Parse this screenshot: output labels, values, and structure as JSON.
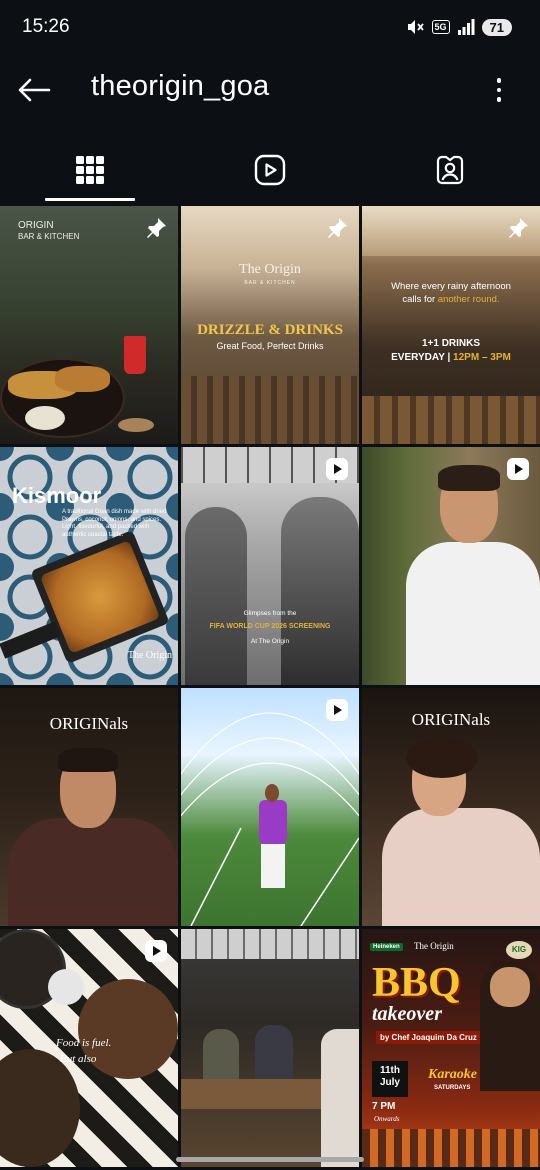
{
  "status_bar": {
    "time": "15:26",
    "network": "5G",
    "battery": "71"
  },
  "header": {
    "username": "theorigin_goa"
  },
  "tabs": [
    {
      "name": "posts-grid",
      "icon": "grid-icon",
      "selected": true
    },
    {
      "name": "reels",
      "icon": "reels-play-icon",
      "selected": false
    },
    {
      "name": "tagged",
      "icon": "tagged-person-icon",
      "selected": false
    }
  ],
  "posts": [
    {
      "pinned": true,
      "logo_line1": "ORIGIN",
      "logo_line2": "BAR & KITCHEN"
    },
    {
      "pinned": true,
      "logo": "The Origin",
      "logo_sub": "BAR & KITCHEN",
      "headline": "DRIZZLE & DRINKS",
      "subline": "Great Food, Perfect Drinks"
    },
    {
      "pinned": true,
      "line1": "Where every rainy afternoon",
      "line2a": "calls for ",
      "line2b": "another round.",
      "offer": "1+1 DRINKS",
      "hours_a": "EVERYDAY | ",
      "hours_b": "12PM – 3PM"
    },
    {
      "title": "Kismoor",
      "desc": "A traditional Goan dish made with dried Prawns, coconut, onions, and spices. Light, flavourful, and packed with authentic coastal taste.",
      "logo": "The Origin"
    },
    {
      "video": true,
      "line1": "Glimpses from the",
      "line2": "FIFA WORLD CUP 2026 SCREENING",
      "line3": "At The Origin"
    },
    {
      "video": true
    },
    {
      "logo": "ORIGINals"
    },
    {
      "video": true
    },
    {
      "logo": "ORIGINals"
    },
    {
      "video": true,
      "line1": "Food is fuel.",
      "line2": "But also"
    },
    {},
    {
      "brand1": "Heineken",
      "brand2": "The Origin",
      "title1": "BBQ",
      "title2": "takeover",
      "chef": "by Chef Joaquim Da Cruz",
      "date": "11th July",
      "time": "7 PM",
      "onwards": "Onwards",
      "event1": "Karaoke",
      "event2": "SATURDAYS",
      "sponsor": "KIG"
    }
  ],
  "colors": {
    "background": "#0c1014",
    "accent_gold": "#e3b13c",
    "tab_indicator": "#ffffff"
  }
}
